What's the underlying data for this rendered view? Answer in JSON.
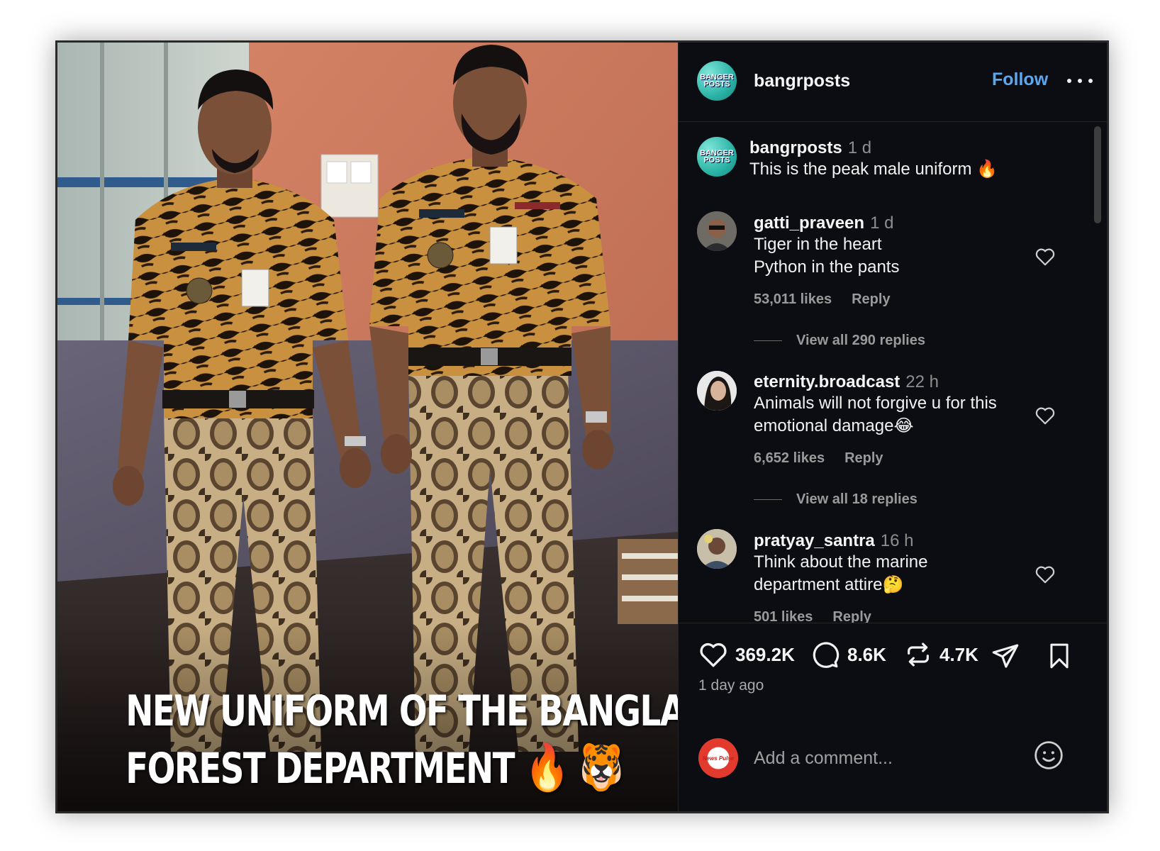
{
  "post": {
    "caption_line1": "NEW UNIFORM OF THE BANGLADESH",
    "caption_line2": "FOREST DEPARTMENT",
    "caption_emojis": "🔥 🐯"
  },
  "header": {
    "avatar_text": "BANGER POSTS",
    "username": "bangrposts",
    "follow_label": "Follow"
  },
  "owner_caption": {
    "username": "bangrposts",
    "time": "1 d",
    "text": "This is the peak male uniform",
    "emoji": "🔥"
  },
  "comments": [
    {
      "username": "gatti_praveen",
      "time": "1 d",
      "line1": "Tiger in the heart",
      "line2": "Python in the pants",
      "likes": "53,011 likes",
      "reply": "Reply",
      "view_replies": "View all 290 replies"
    },
    {
      "username": "eternity.broadcast",
      "time": "22 h",
      "line1": "Animals will not forgive u for this",
      "line2": "emotional damage",
      "emoji": "😂",
      "likes": "6,652 likes",
      "reply": "Reply",
      "view_replies": "View all 18 replies"
    },
    {
      "username": "pratyay_santra",
      "time": "16 h",
      "line1": "Think about the marine",
      "line2": "department attire",
      "emoji": "🤔",
      "likes": "501 likes",
      "reply": "Reply"
    }
  ],
  "actions": {
    "likes": "369.2K",
    "comments": "8.6K",
    "reposts": "4.7K"
  },
  "posted_ago": "1 day ago",
  "comment_box": {
    "avatar_text": "News Pulse",
    "placeholder": "Add a comment..."
  },
  "colors": {
    "panel_bg": "#0b0d12",
    "accent_follow": "#5aa8ef",
    "muted_text": "#9a9a9a"
  },
  "icons": [
    "more-icon",
    "heart-icon",
    "comment-icon",
    "repost-icon",
    "share-icon",
    "bookmark-icon",
    "emoji-icon"
  ]
}
